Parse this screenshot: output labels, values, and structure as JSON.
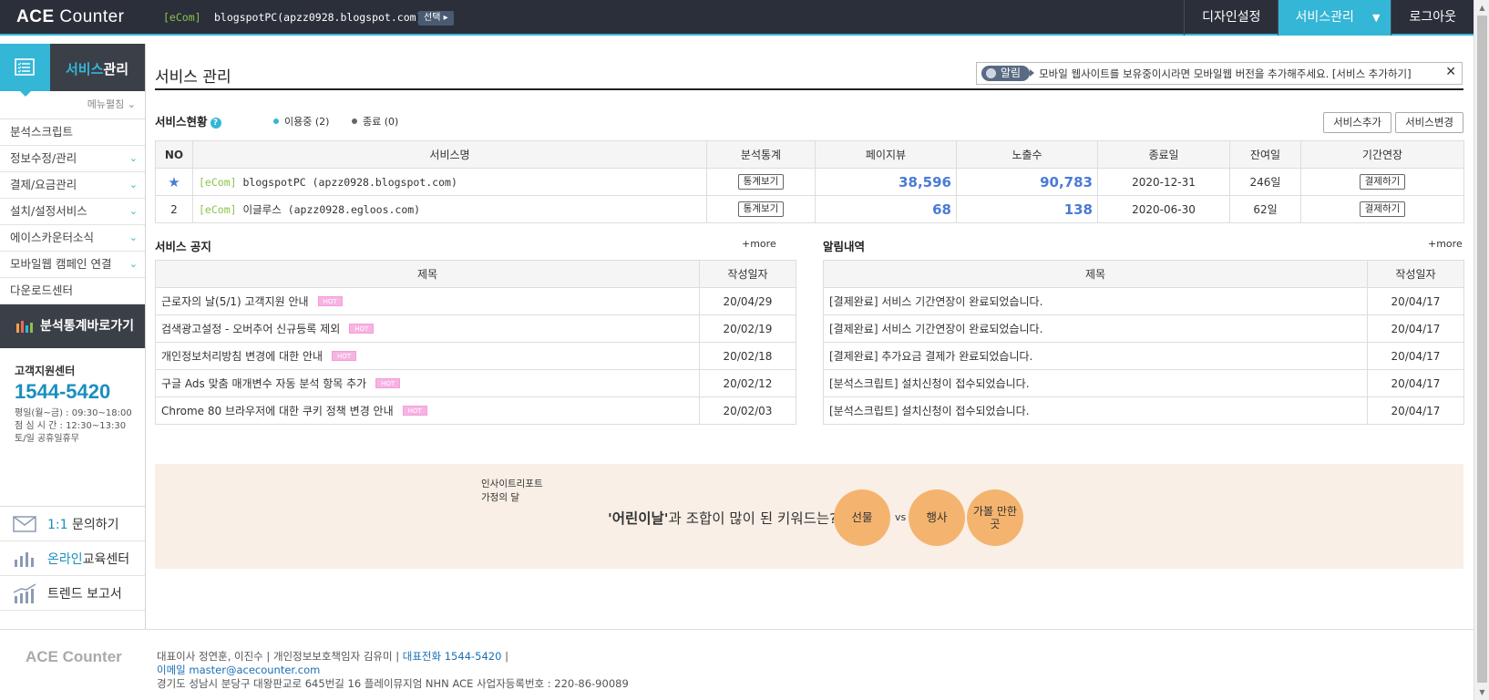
{
  "topbar": {
    "logo_bold": "ACE",
    "logo_thin": " Counter",
    "ecom_tag": "[eCom]",
    "site": "blogspotPC(apzz0928.blogspot.com)",
    "select_label": "선택 ▸",
    "design_settings": "디자인설정",
    "service_manage": "서비스관리",
    "logout": "로그아웃"
  },
  "sidebar": {
    "title_hl": "서비스",
    "title_rest": "관리",
    "menu_fold": "메뉴펼침 ⌄",
    "items": [
      {
        "label": "분석스크립트",
        "chev": ""
      },
      {
        "label": "정보수정/관리",
        "chev": "⌄"
      },
      {
        "label": "결제/요금관리",
        "chev": "⌄"
      },
      {
        "label": "설치/설정서비스",
        "chev": "⌄"
      },
      {
        "label": "에이스카운터소식",
        "chev": "⌄"
      },
      {
        "label": "모바일웹 캠페인 연결",
        "chev": "⌄"
      },
      {
        "label": "다운로드센터",
        "chev": ""
      }
    ],
    "shortcut": "분석통계바로가기",
    "cs_label": "고객지원센터",
    "cs_phone": "1544-5420",
    "cs_hours1": "평일(월~금) : 09:30~18:00",
    "cs_hours2": "점 심 시 간 : 12:30~13:30",
    "cs_hours3": "토/일 공휴일휴무",
    "link_inquiry_hl": "1:1",
    "link_inquiry": " 문의하기",
    "link_edu_hl": "온라인",
    "link_edu": "교육센터",
    "link_trend": "트렌드 보고서"
  },
  "main": {
    "page_title": "서비스 관리",
    "alert_pill": "알림",
    "alert_text": "모바일 웹사이트를 보유중이시라면 모바일웹 버전을 추가해주세요. [서비스 추가하기]",
    "alert_close": "✕",
    "status_title": "서비스현황",
    "status_active": "이용중 (2)",
    "status_ended": "종료 (0)",
    "btn_add": "서비스추가",
    "btn_change": "서비스변경",
    "svc_headers": [
      "NO",
      "서비스명",
      "분석통계",
      "페이지뷰",
      "노출수",
      "종료일",
      "잔여일",
      "기간연장"
    ],
    "services": [
      {
        "no": "",
        "ecom": "[eCom]",
        "name": " blogspotPC (apzz0928.blogspot.com)",
        "stat": "통계보기",
        "pv": "38,596",
        "exp": "90,783",
        "end": "2020-12-31",
        "remain": "246일",
        "extend": "결제하기"
      },
      {
        "no": "2",
        "ecom": "[eCom]",
        "name": " 이글루스 (apzz0928.egloos.com)",
        "stat": "통계보기",
        "pv": "68",
        "exp": "138",
        "end": "2020-06-30",
        "remain": "62일",
        "extend": "결제하기"
      }
    ],
    "notice_title": "서비스 공지",
    "notice_more": "+more",
    "notice_headers": [
      "제목",
      "작성일자"
    ],
    "notices": [
      {
        "title": "근로자의 날(5/1) 고객지원 안내",
        "hot": "HOT",
        "date": "20/04/29"
      },
      {
        "title": "검색광고설정 - 오버추어 신규등록 제외",
        "hot": "HOT",
        "date": "20/02/19"
      },
      {
        "title": "개인정보처리방침 변경에 대한 안내",
        "hot": "HOT",
        "date": "20/02/18"
      },
      {
        "title": "구글 Ads 맞춤 매개변수 자동 분석 항목 추가",
        "hot": "HOT",
        "date": "20/02/12"
      },
      {
        "title": "Chrome 80 브라우저에 대한 쿠키 정책 변경 안내",
        "hot": "HOT",
        "date": "20/02/03"
      }
    ],
    "alerts_title": "알림내역",
    "alerts_more": "+more",
    "alerts_headers": [
      "제목",
      "작성일자"
    ],
    "alerts": [
      {
        "title": "[결제완료] 서비스 기간연장이 완료되었습니다.",
        "date": "20/04/17"
      },
      {
        "title": "[결제완료] 서비스 기간연장이 완료되었습니다.",
        "date": "20/04/17"
      },
      {
        "title": "[결제완료] 추가요금 결제가 완료되었습니다.",
        "date": "20/04/17"
      },
      {
        "title": "[분석스크립트] 설치신청이 접수되었습니다.",
        "date": "20/04/17"
      },
      {
        "title": "[분석스크립트] 설치신청이 접수되었습니다.",
        "date": "20/04/17"
      }
    ],
    "banner_sub1": "인사이트리포트",
    "banner_sub2": "가정의 달",
    "banner_q_bold": "'어린이날'",
    "banner_q": "과 조합이 많이 된 키워드는?",
    "bubble1": "선물",
    "bubble2": "행사",
    "bubble3": "가볼 만한 곳",
    "vs": "vs"
  },
  "footer": {
    "logo": "ACE Counter",
    "line1a": "대표이사 정연훈, 이진수 | 개인정보보호책임자 김유미 | ",
    "line1b": "대표전화 1544-5420",
    "line1c": " |",
    "line2": "이메일 master@acecounter.com",
    "line3": "경기도 성남시 분당구 대왕판교로 645번길 16 플레이뮤지엄 NHN ACE 사업자등록번호 : 220-86-90089"
  },
  "colors": {
    "accent": "#34b6d6",
    "dark": "#2b2f3a",
    "number": "#4a7bd6",
    "banner_bg": "#f9efe6",
    "bubble": "#f4b46f"
  }
}
